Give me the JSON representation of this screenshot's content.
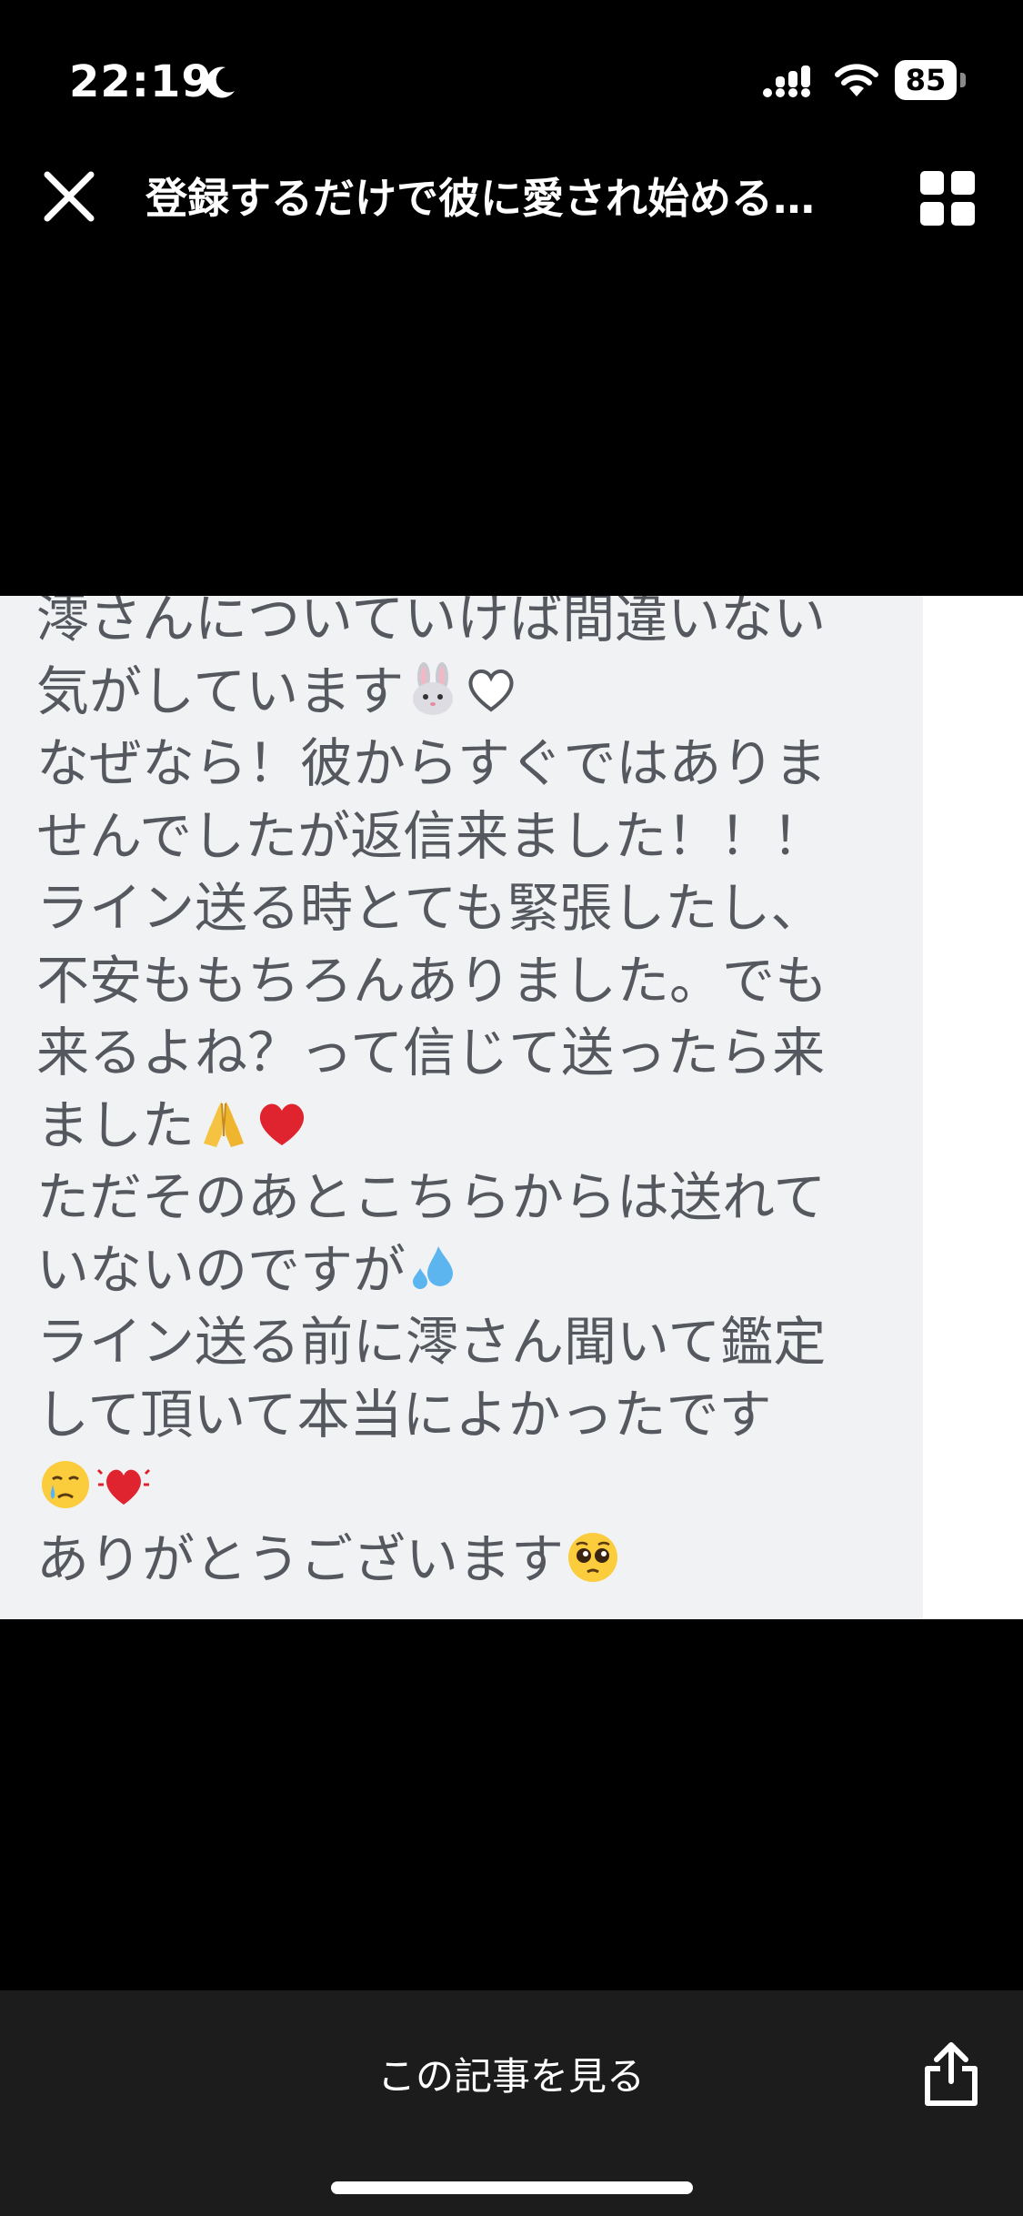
{
  "status_bar": {
    "time": "22:19",
    "battery_level": "85"
  },
  "header": {
    "title": "登録するだけで彼に愛され始める…"
  },
  "message": {
    "lines": [
      "澪さんについていけば間違いない",
      "気がしています",
      "なぜなら！彼からすぐではありま",
      "せんでしたが返信来ました！！！",
      "ライン送る時とても緊張したし、",
      "不安ももちろんありました。でも",
      "来るよね？って信じて送ったら来",
      "ました",
      "ただそのあとこちらからは送れて",
      "いないのですが",
      "ライン送る前に澪さん聞いて鑑定",
      "して頂いて本当によかったです",
      "",
      "ありがとうございます"
    ],
    "emoji_names": [
      "rabbit-emoji",
      "white-heart-emoji",
      "folded-hands-emoji",
      "red-heart-emoji",
      "sweat-droplets-emoji",
      "crying-face-emoji",
      "beating-heart-emoji",
      "pleading-face-emoji"
    ]
  },
  "bottom_bar": {
    "view_article_label": "この記事を見る"
  },
  "colors": {
    "background": "#000000",
    "message_panel": "#f1f2f4",
    "message_text": "#55585e",
    "bottom_bar": "#1c1c1c"
  }
}
